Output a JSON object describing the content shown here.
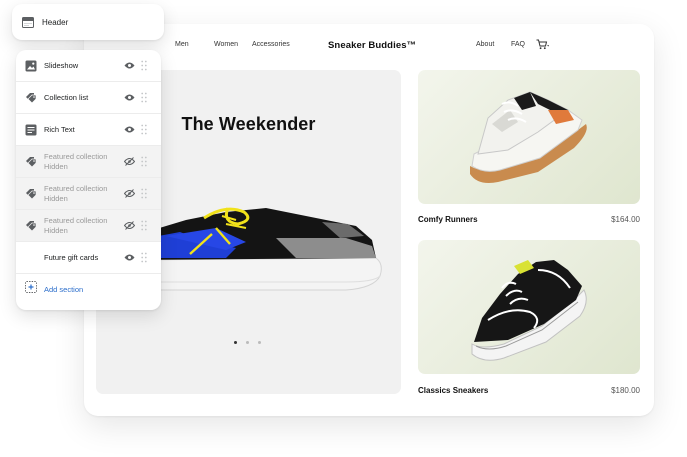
{
  "store": {
    "nav_left": [
      "Men",
      "Women",
      "Accessories"
    ],
    "brand": "Sneaker Buddies™",
    "nav_right": [
      "About",
      "FAQ"
    ],
    "cart_icon": "cart-icon",
    "hero": {
      "title": "The Weekender",
      "slides": 3,
      "active_slide": 1
    },
    "products": [
      {
        "name": "Comfy Runners",
        "price": "$164.00"
      },
      {
        "name": "Classics Sneakers",
        "price": "$180.00"
      }
    ]
  },
  "editor": {
    "header_label": "Header",
    "header_icon": "header-layout-icon",
    "sections": [
      {
        "label": "Slideshow",
        "icon": "image-icon",
        "hidden": false
      },
      {
        "label": "Collection list",
        "icon": "tags-icon",
        "hidden": false
      },
      {
        "label": "Rich Text",
        "icon": "text-block-icon",
        "hidden": false
      },
      {
        "label": "Featured collection",
        "sub": "Hidden",
        "icon": "tags-icon",
        "hidden": true
      },
      {
        "label": "Featured collection",
        "sub": "Hidden",
        "icon": "tags-icon",
        "hidden": true
      },
      {
        "label": "Featured collection",
        "sub": "Hidden",
        "icon": "tags-icon",
        "hidden": true
      },
      {
        "label": "Future gift cards",
        "icon": "none",
        "hidden": false
      }
    ],
    "add_section_label": "Add section"
  },
  "colors": {
    "accent_link": "#2c6ecb",
    "shoe_blue": "#1f3fd6",
    "shoe_yellow": "#f1e21a"
  }
}
